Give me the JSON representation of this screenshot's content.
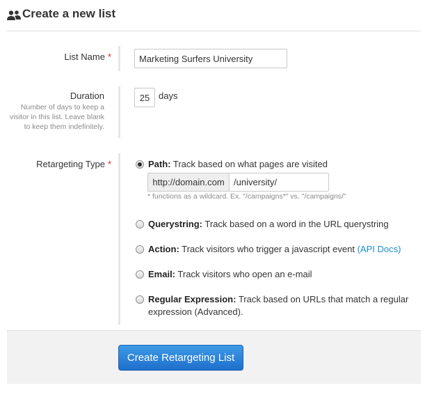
{
  "header": {
    "title": "Create a new list",
    "icon": "users-icon"
  },
  "list_name": {
    "label": "List Name",
    "required_mark": "*",
    "value": "Marketing Surfers University"
  },
  "duration": {
    "label": "Duration",
    "help": "Number of days to keep a visitor in this list. Leave blank to keep them indefinitely.",
    "value": "25",
    "unit": "days"
  },
  "retargeting": {
    "label": "Retargeting Type",
    "required_mark": "*",
    "options": [
      {
        "name": "Path:",
        "desc": "Track based on what pages are visited",
        "checked": true
      },
      {
        "name": "Querystring:",
        "desc": "Track based on a word in the URL querystring",
        "checked": false
      },
      {
        "name": "Action:",
        "desc": "Track visitors who trigger a javascript event",
        "link": "(API Docs)",
        "checked": false
      },
      {
        "name": "Email:",
        "desc": "Track visitors who open an e-mail",
        "checked": false
      },
      {
        "name": "Regular Expression:",
        "desc": "Track based on URLs that match a regular",
        "desc2": "expression (Advanced).",
        "checked": false
      }
    ],
    "path": {
      "prefix": "http://domain.com",
      "value": "/university/",
      "hint": "* functions as a wildcard. Ex. \"/campaigns*\" vs. \"/campaigns/\""
    }
  },
  "submit_label": "Create Retargeting List",
  "colors": {
    "accent": "#1f6fcc",
    "link": "#1a8fd4",
    "required": "#d9262b"
  }
}
